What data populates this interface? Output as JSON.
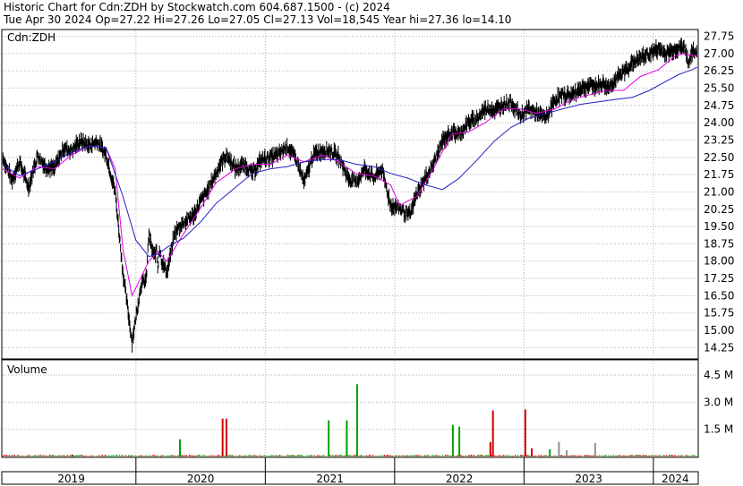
{
  "header": {
    "title": "Historic Chart for Cdn:ZDH by Stockwatch.com 604.687.1500 - (c) 2024",
    "quote": "Tue Apr 30 2024   Op=27.22   Hi=27.26   Lo=27.05   Cl=27.13   Vol=18,545   Year hi=27.36   lo=14.10"
  },
  "colors": {
    "price_bars": "#000000",
    "ma_short": "#e000e0",
    "ma_long": "#2020c0",
    "volume_up": "#00a000",
    "volume_down": "#d00000",
    "volume_neutral": "#909090",
    "grid": "#b0b0b0",
    "frame": "#000000"
  },
  "chart_data": [
    {
      "type": "line",
      "label": "Cdn:ZDH",
      "grid": true,
      "y_axis_side": "right",
      "ylim": [
        13.8,
        28.0
      ],
      "y_ticks": [
        "27.75",
        "27.00",
        "26.25",
        "25.50",
        "24.75",
        "24.00",
        "23.25",
        "22.50",
        "21.75",
        "21.00",
        "20.25",
        "19.50",
        "18.75",
        "18.00",
        "17.25",
        "16.50",
        "15.75",
        "15.00",
        "14.25"
      ],
      "x_ticks": [
        "2019",
        "2020",
        "2021",
        "2022",
        "2023",
        "2024"
      ],
      "x_range": [
        2018.97,
        2024.34
      ],
      "series": [
        {
          "kind": "price",
          "x": [
            2018.97,
            2019.04,
            2019.1,
            2019.17,
            2019.24,
            2019.3,
            2019.37,
            2019.44,
            2019.5,
            2019.57,
            2019.64,
            2019.7,
            2019.77,
            2019.84,
            2019.9,
            2019.97,
            2020.04,
            2020.08,
            2020.1,
            2020.12,
            2020.14,
            2020.16,
            2020.17,
            2020.18,
            2020.2,
            2020.24,
            2020.3,
            2020.35,
            2020.4,
            2020.45,
            2020.5,
            2020.55,
            2020.6,
            2020.62,
            2020.65,
            2020.7,
            2020.77,
            2020.84,
            2020.9,
            2020.97,
            2021.04,
            2021.1,
            2021.17,
            2021.24,
            2021.3,
            2021.37,
            2021.44,
            2021.5,
            2021.57,
            2021.64,
            2021.7,
            2021.77,
            2021.84,
            2021.9,
            2021.97,
            2022.04,
            2022.1,
            2022.12,
            2022.17,
            2022.24,
            2022.3,
            2022.37,
            2022.44,
            2022.5,
            2022.57,
            2022.64,
            2022.7,
            2022.75,
            2022.77,
            2022.84,
            2022.9,
            2022.97,
            2023.04,
            2023.1,
            2023.17,
            2023.24,
            2023.3,
            2023.37,
            2023.44,
            2023.5,
            2023.57,
            2023.62,
            2023.64,
            2023.7,
            2023.77,
            2023.84,
            2023.9,
            2023.97,
            2024.04,
            2024.1,
            2024.17,
            2024.24,
            2024.27,
            2024.3,
            2024.34
          ],
          "y": [
            22.5,
            21.5,
            22.3,
            21.2,
            22.6,
            22.1,
            22.0,
            22.9,
            22.8,
            23.2,
            23.0,
            23.2,
            22.6,
            21.0,
            17.5,
            14.5,
            17.0,
            17.2,
            19.2,
            18.6,
            18.2,
            18.5,
            17.6,
            18.6,
            18.0,
            17.5,
            19.2,
            19.6,
            19.8,
            20.0,
            20.6,
            21.0,
            21.6,
            21.8,
            22.2,
            22.6,
            22.0,
            22.2,
            21.8,
            22.4,
            22.5,
            22.6,
            23.0,
            22.4,
            21.4,
            22.6,
            22.8,
            22.8,
            22.5,
            21.6,
            21.4,
            22.0,
            21.6,
            22.0,
            20.4,
            20.3,
            20.0,
            20.0,
            20.9,
            21.6,
            22.2,
            23.2,
            23.6,
            23.5,
            24.0,
            24.2,
            24.6,
            24.6,
            24.5,
            24.8,
            24.9,
            24.3,
            24.6,
            24.4,
            24.2,
            25.0,
            25.2,
            25.2,
            25.5,
            25.6,
            25.6,
            25.7,
            25.5,
            25.8,
            26.2,
            26.6,
            26.8,
            27.0,
            27.2,
            27.0,
            27.2,
            27.3,
            26.6,
            27.0,
            27.13
          ]
        },
        {
          "kind": "moving_average_short",
          "x": [
            2018.97,
            2019.1,
            2019.24,
            2019.37,
            2019.5,
            2019.64,
            2019.77,
            2019.84,
            2019.9,
            2019.97,
            2020.04,
            2020.1,
            2020.17,
            2020.24,
            2020.37,
            2020.5,
            2020.62,
            2020.77,
            2020.9,
            2021.04,
            2021.17,
            2021.3,
            2021.44,
            2021.57,
            2021.7,
            2021.84,
            2021.97,
            2022.04,
            2022.1,
            2022.17,
            2022.3,
            2022.44,
            2022.57,
            2022.7,
            2022.84,
            2022.97,
            2023.1,
            2023.24,
            2023.37,
            2023.5,
            2023.64,
            2023.77,
            2023.9,
            2024.04,
            2024.17,
            2024.24,
            2024.3,
            2024.34
          ],
          "y": [
            22.0,
            21.6,
            22.1,
            22.0,
            22.6,
            23.0,
            22.9,
            22.0,
            18.5,
            16.5,
            17.3,
            18.0,
            18.4,
            18.0,
            19.2,
            20.3,
            21.4,
            22.0,
            22.2,
            22.2,
            22.6,
            22.3,
            22.6,
            22.3,
            21.8,
            21.7,
            21.3,
            20.4,
            20.6,
            20.8,
            22.0,
            23.5,
            23.6,
            24.0,
            24.6,
            24.6,
            24.4,
            24.6,
            25.0,
            25.2,
            25.4,
            25.4,
            26.0,
            26.3,
            26.9,
            27.0,
            26.9,
            26.9
          ]
        },
        {
          "kind": "moving_average_long",
          "x": [
            2018.97,
            2019.1,
            2019.24,
            2019.37,
            2019.5,
            2019.64,
            2019.77,
            2019.9,
            2020.0,
            2020.1,
            2020.17,
            2020.24,
            2020.37,
            2020.5,
            2020.62,
            2020.77,
            2020.9,
            2021.04,
            2021.17,
            2021.3,
            2021.44,
            2021.57,
            2021.7,
            2021.84,
            2021.97,
            2022.1,
            2022.24,
            2022.37,
            2022.5,
            2022.64,
            2022.77,
            2022.9,
            2023.04,
            2023.17,
            2023.3,
            2023.44,
            2023.57,
            2023.7,
            2023.84,
            2023.97,
            2024.1,
            2024.2,
            2024.3,
            2024.34
          ],
          "y": [
            22.2,
            21.7,
            22.0,
            22.3,
            22.7,
            23.0,
            22.9,
            20.8,
            18.9,
            18.2,
            18.3,
            18.6,
            19.0,
            19.7,
            20.5,
            21.2,
            21.8,
            22.0,
            22.1,
            22.3,
            22.4,
            22.4,
            22.2,
            22.1,
            21.8,
            21.6,
            21.3,
            21.1,
            21.6,
            22.4,
            23.2,
            23.8,
            24.2,
            24.4,
            24.6,
            24.8,
            24.9,
            25.0,
            25.1,
            25.4,
            25.8,
            26.1,
            26.3,
            26.4
          ]
        }
      ]
    },
    {
      "type": "bar",
      "label": "Volume",
      "grid": true,
      "y_axis_side": "right",
      "ylim": [
        0,
        5.3
      ],
      "y_ticks": [
        "4.5 M",
        "3.0 M",
        "1.5 M"
      ],
      "x_range": [
        2018.97,
        2024.34
      ],
      "bars": [
        {
          "x": 2019.51,
          "v": 0.1,
          "c": "down"
        },
        {
          "x": 2020.34,
          "v": 0.95,
          "c": "up"
        },
        {
          "x": 2020.67,
          "v": 2.1,
          "c": "down"
        },
        {
          "x": 2020.7,
          "v": 2.1,
          "c": "down"
        },
        {
          "x": 2021.49,
          "v": 2.0,
          "c": "up"
        },
        {
          "x": 2021.63,
          "v": 2.0,
          "c": "up"
        },
        {
          "x": 2021.71,
          "v": 4.0,
          "c": "up"
        },
        {
          "x": 2022.45,
          "v": 1.75,
          "c": "up"
        },
        {
          "x": 2022.5,
          "v": 1.65,
          "c": "up"
        },
        {
          "x": 2022.74,
          "v": 0.8,
          "c": "down"
        },
        {
          "x": 2022.76,
          "v": 2.55,
          "c": "down"
        },
        {
          "x": 2023.01,
          "v": 2.6,
          "c": "down"
        },
        {
          "x": 2023.06,
          "v": 0.45,
          "c": "down"
        },
        {
          "x": 2023.2,
          "v": 0.4,
          "c": "up"
        },
        {
          "x": 2023.27,
          "v": 0.8,
          "c": "neutral"
        },
        {
          "x": 2023.33,
          "v": 0.35,
          "c": "neutral"
        },
        {
          "x": 2023.55,
          "v": 0.75,
          "c": "neutral"
        }
      ]
    }
  ]
}
